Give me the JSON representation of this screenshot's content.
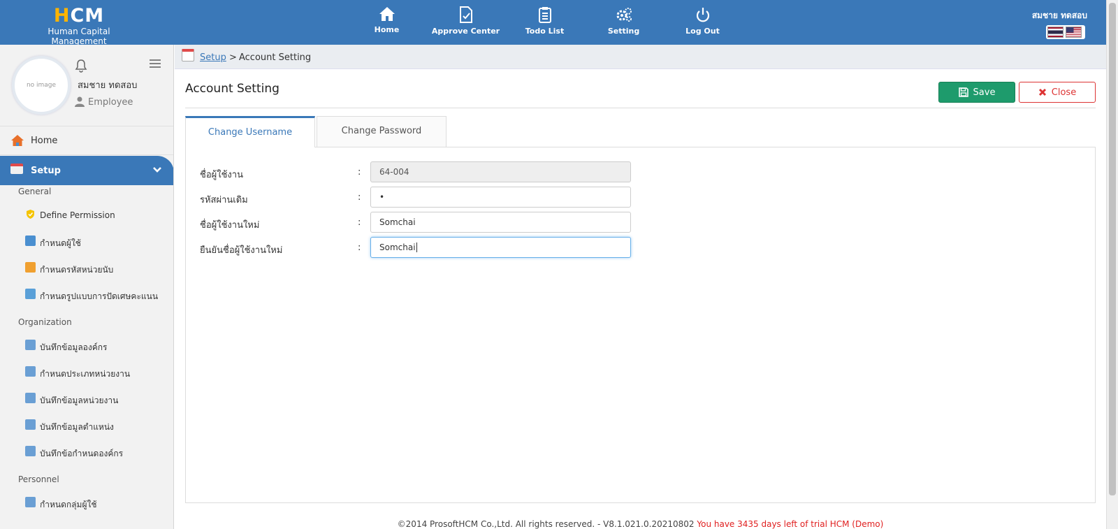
{
  "app": {
    "logo_mark_h": "H",
    "logo_mark_rest": "CM",
    "logo_subtitle": "Human Capital Management"
  },
  "nav": {
    "home": "Home",
    "approve": "Approve Center",
    "todo": "Todo List",
    "setting": "Setting",
    "logout": "Log Out"
  },
  "top_user": "สมชาย ทดสอบ",
  "sidebar": {
    "avatar_text": "no image",
    "user_name": "สมชาย ทดสอบ",
    "user_role": "Employee",
    "home": "Home",
    "setup": "Setup",
    "sections": {
      "general": "General",
      "organization": "Organization",
      "personnel": "Personnel"
    },
    "general_items": [
      {
        "label": "Define Permission",
        "icon": "shield-icon",
        "color": "#f5c400"
      },
      {
        "label": "กำหนดผู้ใช้",
        "icon": "users-icon",
        "color": "#4a8fd0"
      },
      {
        "label": "กำหนดรหัสหน่วยนับ",
        "icon": "unit-icon",
        "color": "#f0a030"
      },
      {
        "label": "กำหนดรูปแบบการปัดเศษคะแนน",
        "icon": "rounding-icon",
        "color": "#5aa0d8"
      }
    ],
    "organization_items": [
      {
        "label": "บันทึกข้อมูลองค์กร",
        "icon": "building-icon",
        "color": "#6a9fd4"
      },
      {
        "label": "กำหนดประเภทหน่วยงาน",
        "icon": "building-icon",
        "color": "#6a9fd4"
      },
      {
        "label": "บันทึกข้อมูลหน่วยงาน",
        "icon": "building-icon",
        "color": "#6a9fd4"
      },
      {
        "label": "บันทึกข้อมูลตำแหน่ง",
        "icon": "position-icon",
        "color": "#6a9fd4"
      },
      {
        "label": "บันทึกข้อกำหนดองค์กร",
        "icon": "building-icon",
        "color": "#6a9fd4"
      }
    ],
    "personnel_items": [
      {
        "label": "กำหนดกลุ่มผู้ใช้",
        "icon": "group-icon",
        "color": "#6a9fd4"
      }
    ]
  },
  "breadcrumb": {
    "link": "Setup",
    "separator": ">",
    "current": "Account Setting"
  },
  "page": {
    "title": "Account Setting",
    "save_label": "Save",
    "close_label": "Close"
  },
  "tabs": {
    "change_username": "Change Username",
    "change_password": "Change Password"
  },
  "form": {
    "colon": ":",
    "username_label": "ชื่อผู้ใช้งาน",
    "username_value": "64-004",
    "old_password_label": "รหัสผ่านเดิม",
    "old_password_value": "•",
    "new_username_label": "ชื่อผู้ใช้งานใหม่",
    "new_username_value": "Somchai",
    "confirm_username_label": "ยืนยันชื่อผู้ใช้งานใหม่",
    "confirm_username_value": "Somchai"
  },
  "footer": {
    "text": "©2014 ProsoftHCM Co.,Ltd. All rights reserved.  -  V8.1.021.0.20210802",
    "trial": "You have 3435 days left of trial HCM (Demo)"
  },
  "colors": {
    "brand_blue": "#3a78b8",
    "save_green": "#1e9b6c",
    "close_red": "#dd3333"
  }
}
